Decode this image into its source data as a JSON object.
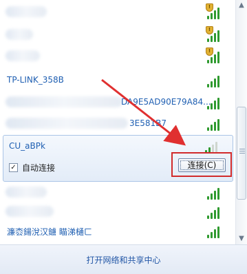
{
  "networks": [
    {
      "ssid": "",
      "blurred": true,
      "secured": true,
      "signal_level": 4
    },
    {
      "ssid": "",
      "blurred": true,
      "secured": true,
      "signal_level": 4
    },
    {
      "ssid": "",
      "blurred": true,
      "secured": true,
      "signal_level": 4
    },
    {
      "ssid": "TP-LINK_358B",
      "blurred": false,
      "secured": false,
      "signal_level": 4
    },
    {
      "ssid": "DA9E5AD90E79A84...",
      "blurred": true,
      "secured": false,
      "signal_level": 4
    },
    {
      "ssid": "3E581B7",
      "blurred": true,
      "secured": false,
      "signal_level": 4
    }
  ],
  "selected": {
    "ssid": "CU_aBPk",
    "auto_connect_label": "自动连接",
    "auto_connect_checked": true,
    "check_mark": "✓",
    "connect_button_label": "连接(C)",
    "signal_level": 2
  },
  "lower_networks": [
    {
      "ssid": "",
      "blurred": true,
      "signal_level": 4
    },
    {
      "ssid": "",
      "blurred": true,
      "signal_level": 4
    },
    {
      "ssid": "濂枩鍚涗汉鐪   瞄涕樋ㄈ",
      "blurred": false,
      "signal_level": 4
    }
  ],
  "footer": {
    "link_label": "打开网络和共享中心"
  },
  "colors": {
    "signal_green": "#2f9a2f",
    "link_blue": "#1f5fb2",
    "highlight_red": "#d12a2a"
  },
  "icons": {
    "signal": "wifi-signal-icon",
    "secured": "shield-icon",
    "checkbox": "checkbox-icon",
    "scroll_up": "chevron-up-icon",
    "scroll_down": "chevron-down-icon"
  }
}
